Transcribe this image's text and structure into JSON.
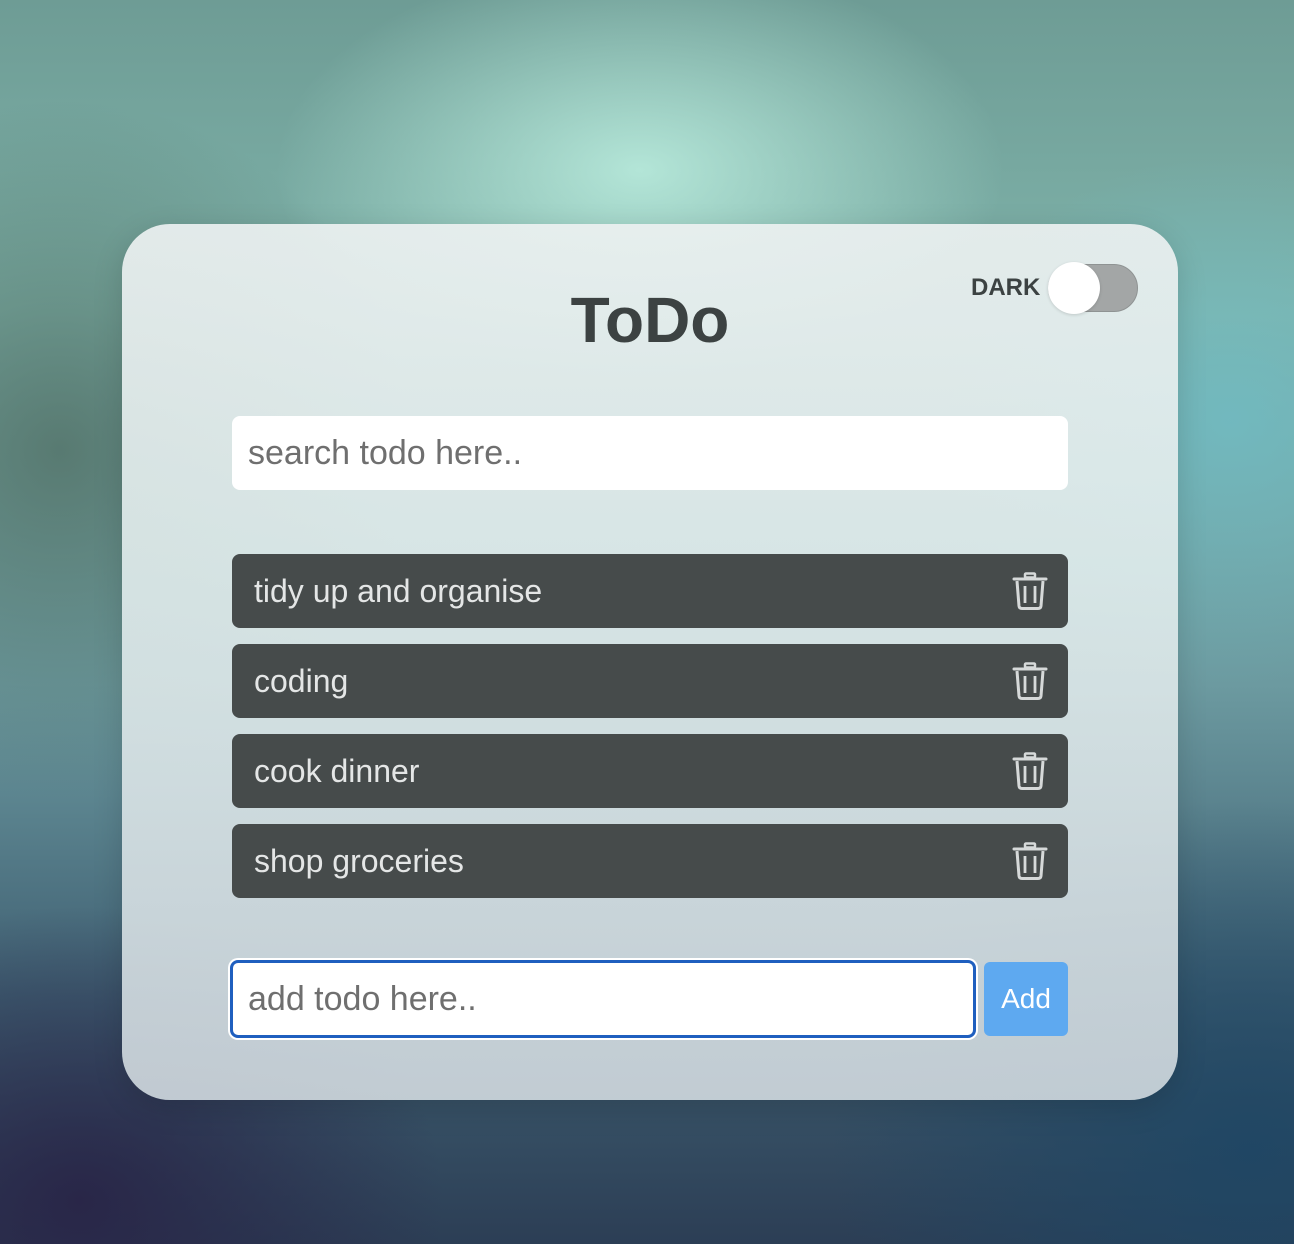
{
  "app": {
    "title": "ToDo"
  },
  "theme_toggle": {
    "label": "DARK",
    "state": "off"
  },
  "search": {
    "placeholder": "search todo here..",
    "value": ""
  },
  "todos": [
    {
      "text": "tidy up and organise",
      "icon": "trash-icon"
    },
    {
      "text": "coding",
      "icon": "trash-icon"
    },
    {
      "text": "cook dinner",
      "icon": "trash-icon"
    },
    {
      "text": "shop groceries",
      "icon": "trash-icon"
    }
  ],
  "add_form": {
    "placeholder": "add todo here..",
    "value": "",
    "button_label": "Add"
  },
  "colors": {
    "item_background": "#464b4b",
    "item_text": "#e4e6e6",
    "title_text": "#3c4242",
    "add_button": "#5ea9f0",
    "focus_border": "#1f5fbf"
  }
}
